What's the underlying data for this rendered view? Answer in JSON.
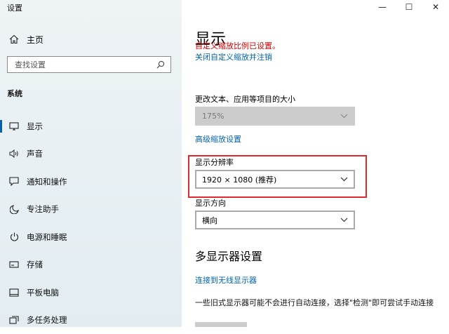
{
  "window": {
    "title": "设置",
    "controls": {
      "minimize": "—",
      "maximize": "☐",
      "close": "✕"
    }
  },
  "sidebar": {
    "home": {
      "label": "主页",
      "icon": "home-icon"
    },
    "search": {
      "placeholder": "查找设置",
      "icon": "search-icon"
    },
    "section_title": "系统",
    "items": [
      {
        "label": "显示",
        "icon": "monitor-icon",
        "active": true
      },
      {
        "label": "声音",
        "icon": "speaker-icon"
      },
      {
        "label": "通知和操作",
        "icon": "notification-icon"
      },
      {
        "label": "专注助手",
        "icon": "moon-icon"
      },
      {
        "label": "电源和睡眠",
        "icon": "power-icon"
      },
      {
        "label": "存储",
        "icon": "storage-icon"
      },
      {
        "label": "平板电脑",
        "icon": "tablet-icon"
      },
      {
        "label": "多任务处理",
        "icon": "multitask-icon"
      }
    ]
  },
  "main": {
    "title": "显示",
    "custom_scale_warning": "自定义缩放比例已设置。",
    "turn_off_custom_scaling_link": "关闭自定义缩放并注销",
    "scale_label": "更改文本、应用等项目的大小",
    "scale_value": "175%",
    "advanced_scaling_link": "高级缩放设置",
    "resolution_label": "显示分辨率",
    "resolution_value": "1920 × 1080 (推荐)",
    "orientation_label": "显示方向",
    "orientation_value": "横向",
    "multi_display_heading": "多显示器设置",
    "wireless_display_link": "连接到无线显示器",
    "multi_display_desc": "一些旧式显示器可能不会进行自动连接，选择\"检测\"即可尝试手动连接"
  },
  "colors": {
    "accent": "#0063b1",
    "warning_text": "#d40000",
    "highlight_box": "#e1282d",
    "sidebar_bg": "#eaf1f4"
  }
}
